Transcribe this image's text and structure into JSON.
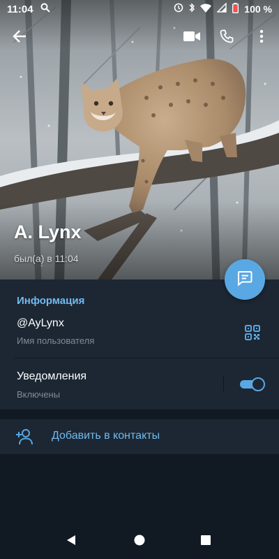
{
  "status_bar": {
    "time": "11:04",
    "battery": "100 %"
  },
  "profile": {
    "name": "A. Lynx",
    "last_seen": "был(а) в 11:04"
  },
  "info": {
    "section_title": "Информация",
    "username": "@AyLynx",
    "username_caption": "Имя пользователя",
    "notifications_title": "Уведомления",
    "notifications_status": "Включены",
    "notifications_enabled": true
  },
  "actions": {
    "add_contact": "Добавить в контакты"
  },
  "icons": {
    "back": "arrow-left-icon",
    "video": "video-camera-icon",
    "call": "phone-icon",
    "more": "more-vertical-icon",
    "message": "message-icon",
    "qr": "qr-code-icon",
    "add_contact": "add-user-icon"
  },
  "colors": {
    "background": "#1c2733",
    "accent": "#5aa8e3",
    "link": "#71baf0",
    "secondary_text": "#7f8c98"
  }
}
